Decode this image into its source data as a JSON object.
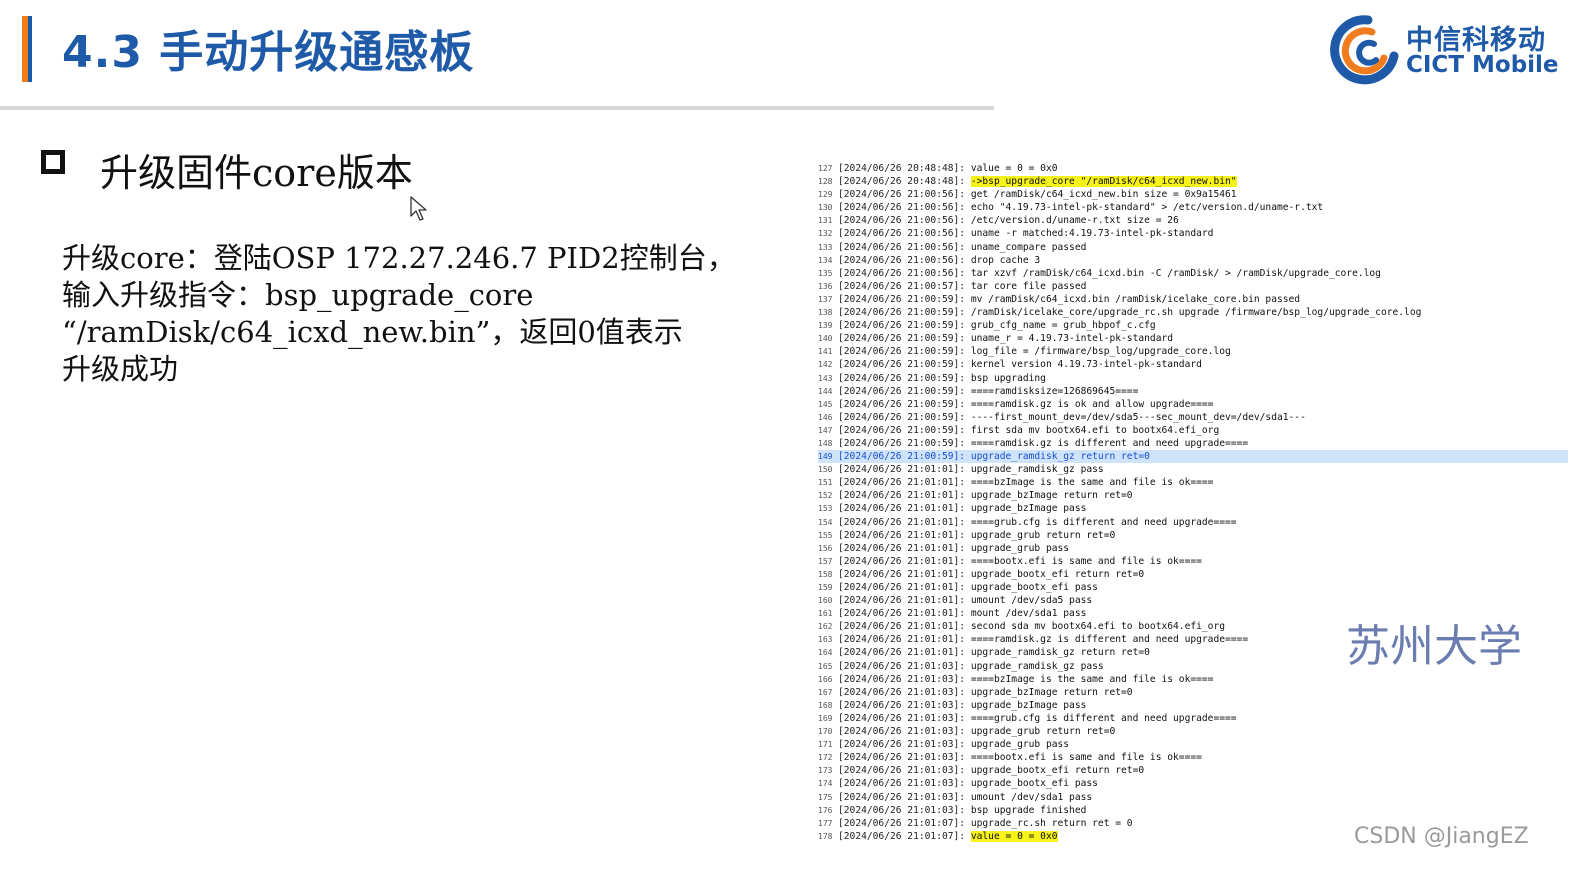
{
  "header": {
    "title": "4.3 手动升级通感板",
    "logo_cn": "中信科移动",
    "logo_en": "CICT Mobile",
    "accent_orange": "#f07c1e",
    "accent_blue": "#1e5aa8"
  },
  "section": {
    "heading": "升级固件core版本",
    "body_lines": [
      "升级core：登陆OSP 172.27.246.7  PID2控制台，",
      "输入升级指令：bsp_upgrade_core",
      "“/ramDisk/c64_icxd_new.bin”，返回0值表示",
      "升级成功"
    ]
  },
  "log": {
    "lines": [
      {
        "n": "127",
        "ts": "[2024/06/26 20:48:48]:",
        "msg": "value = 0 = 0x0",
        "hl": ""
      },
      {
        "n": "128",
        "ts": "[2024/06/26 20:48:48]:",
        "msg": "->bsp_upgrade_core \"/ramDisk/c64_icxd_new.bin\"",
        "hl": "yellow-msg"
      },
      {
        "n": "129",
        "ts": "[2024/06/26 21:00:56]:",
        "msg": "get /ramDisk/c64_icxd_new.bin size = 0x9a15461",
        "hl": ""
      },
      {
        "n": "130",
        "ts": "[2024/06/26 21:00:56]:",
        "msg": "echo \"4.19.73-intel-pk-standard\" > /etc/version.d/uname-r.txt",
        "hl": ""
      },
      {
        "n": "131",
        "ts": "[2024/06/26 21:00:56]:",
        "msg": "/etc/version.d/uname-r.txt size = 26",
        "hl": ""
      },
      {
        "n": "132",
        "ts": "[2024/06/26 21:00:56]:",
        "msg": "uname -r matched:4.19.73-intel-pk-standard",
        "hl": ""
      },
      {
        "n": "133",
        "ts": "[2024/06/26 21:00:56]:",
        "msg": "uname_compare passed",
        "hl": ""
      },
      {
        "n": "134",
        "ts": "[2024/06/26 21:00:56]:",
        "msg": "drop cache 3",
        "hl": ""
      },
      {
        "n": "135",
        "ts": "[2024/06/26 21:00:56]:",
        "msg": "tar xzvf /ramDisk/c64_icxd.bin -C /ramDisk/ > /ramDisk/upgrade_core.log",
        "hl": ""
      },
      {
        "n": "136",
        "ts": "[2024/06/26 21:00:57]:",
        "msg": "tar core file passed",
        "hl": ""
      },
      {
        "n": "137",
        "ts": "[2024/06/26 21:00:59]:",
        "msg": "mv /ramDisk/c64_icxd.bin /ramDisk/icelake_core.bin passed",
        "hl": ""
      },
      {
        "n": "138",
        "ts": "[2024/06/26 21:00:59]:",
        "msg": "/ramDisk/icelake_core/upgrade_rc.sh upgrade /firmware/bsp_log/upgrade_core.log",
        "hl": ""
      },
      {
        "n": "139",
        "ts": "[2024/06/26 21:00:59]:",
        "msg": "grub_cfg_name = grub_hbpof_c.cfg",
        "hl": ""
      },
      {
        "n": "140",
        "ts": "[2024/06/26 21:00:59]:",
        "msg": "uname_r = 4.19.73-intel-pk-standard",
        "hl": ""
      },
      {
        "n": "141",
        "ts": "[2024/06/26 21:00:59]:",
        "msg": "log_file = /firmware/bsp_log/upgrade_core.log",
        "hl": ""
      },
      {
        "n": "142",
        "ts": "[2024/06/26 21:00:59]:",
        "msg": "kernel version 4.19.73-intel-pk-standard",
        "hl": ""
      },
      {
        "n": "143",
        "ts": "[2024/06/26 21:00:59]:",
        "msg": "bsp upgrading",
        "hl": ""
      },
      {
        "n": "144",
        "ts": "[2024/06/26 21:00:59]:",
        "msg": "====ramdisksize=126869645====",
        "hl": ""
      },
      {
        "n": "145",
        "ts": "[2024/06/26 21:00:59]:",
        "msg": "====ramdisk.gz is ok and allow upgrade====",
        "hl": ""
      },
      {
        "n": "146",
        "ts": "[2024/06/26 21:00:59]:",
        "msg": "----first_mount_dev=/dev/sda5---sec_mount_dev=/dev/sda1---",
        "hl": ""
      },
      {
        "n": "147",
        "ts": "[2024/06/26 21:00:59]:",
        "msg": "first sda mv bootx64.efi to bootx64.efi_org",
        "hl": ""
      },
      {
        "n": "148",
        "ts": "[2024/06/26 21:00:59]:",
        "msg": "====ramdisk.gz is different and need upgrade====",
        "hl": ""
      },
      {
        "n": "149",
        "ts": "[2024/06/26 21:00:59]:",
        "msg": "upgrade_ramdisk_gz return ret=0",
        "hl": "blue"
      },
      {
        "n": "150",
        "ts": "[2024/06/26 21:01:01]:",
        "msg": "upgrade_ramdisk_gz pass",
        "hl": ""
      },
      {
        "n": "151",
        "ts": "[2024/06/26 21:01:01]:",
        "msg": "====bzImage is the same and file is ok====",
        "hl": ""
      },
      {
        "n": "152",
        "ts": "[2024/06/26 21:01:01]:",
        "msg": "upgrade_bzImage return ret=0",
        "hl": ""
      },
      {
        "n": "153",
        "ts": "[2024/06/26 21:01:01]:",
        "msg": "upgrade_bzImage pass",
        "hl": ""
      },
      {
        "n": "154",
        "ts": "[2024/06/26 21:01:01]:",
        "msg": "====grub.cfg is different and need upgrade====",
        "hl": ""
      },
      {
        "n": "155",
        "ts": "[2024/06/26 21:01:01]:",
        "msg": "upgrade_grub return ret=0",
        "hl": ""
      },
      {
        "n": "156",
        "ts": "[2024/06/26 21:01:01]:",
        "msg": "upgrade_grub pass",
        "hl": ""
      },
      {
        "n": "157",
        "ts": "[2024/06/26 21:01:01]:",
        "msg": "====bootx.efi is same and file is ok====",
        "hl": ""
      },
      {
        "n": "158",
        "ts": "[2024/06/26 21:01:01]:",
        "msg": "upgrade_bootx_efi return ret=0",
        "hl": ""
      },
      {
        "n": "159",
        "ts": "[2024/06/26 21:01:01]:",
        "msg": "upgrade_bootx_efi pass",
        "hl": ""
      },
      {
        "n": "160",
        "ts": "[2024/06/26 21:01:01]:",
        "msg": "umount /dev/sda5 pass",
        "hl": ""
      },
      {
        "n": "161",
        "ts": "[2024/06/26 21:01:01]:",
        "msg": "mount /dev/sda1 pass",
        "hl": ""
      },
      {
        "n": "162",
        "ts": "[2024/06/26 21:01:01]:",
        "msg": "second sda mv bootx64.efi to bootx64.efi_org",
        "hl": ""
      },
      {
        "n": "163",
        "ts": "[2024/06/26 21:01:01]:",
        "msg": "====ramdisk.gz is different and need upgrade====",
        "hl": ""
      },
      {
        "n": "164",
        "ts": "[2024/06/26 21:01:01]:",
        "msg": "upgrade_ramdisk_gz return ret=0",
        "hl": ""
      },
      {
        "n": "165",
        "ts": "[2024/06/26 21:01:03]:",
        "msg": "upgrade_ramdisk_gz pass",
        "hl": ""
      },
      {
        "n": "166",
        "ts": "[2024/06/26 21:01:03]:",
        "msg": "====bzImage is the same and file is ok====",
        "hl": ""
      },
      {
        "n": "167",
        "ts": "[2024/06/26 21:01:03]:",
        "msg": "upgrade_bzImage return ret=0",
        "hl": ""
      },
      {
        "n": "168",
        "ts": "[2024/06/26 21:01:03]:",
        "msg": "upgrade_bzImage pass",
        "hl": ""
      },
      {
        "n": "169",
        "ts": "[2024/06/26 21:01:03]:",
        "msg": "====grub.cfg is different and need upgrade====",
        "hl": ""
      },
      {
        "n": "170",
        "ts": "[2024/06/26 21:01:03]:",
        "msg": "upgrade_grub return ret=0",
        "hl": ""
      },
      {
        "n": "171",
        "ts": "[2024/06/26 21:01:03]:",
        "msg": "upgrade_grub pass",
        "hl": ""
      },
      {
        "n": "172",
        "ts": "[2024/06/26 21:01:03]:",
        "msg": "====bootx.efi is same and file is ok====",
        "hl": ""
      },
      {
        "n": "173",
        "ts": "[2024/06/26 21:01:03]:",
        "msg": "upgrade_bootx_efi return ret=0",
        "hl": ""
      },
      {
        "n": "174",
        "ts": "[2024/06/26 21:01:03]:",
        "msg": "upgrade_bootx_efi pass",
        "hl": ""
      },
      {
        "n": "175",
        "ts": "[2024/06/26 21:01:03]:",
        "msg": "umount /dev/sda1 pass",
        "hl": ""
      },
      {
        "n": "176",
        "ts": "[2024/06/26 21:01:03]:",
        "msg": "bsp upgrade finished",
        "hl": ""
      },
      {
        "n": "177",
        "ts": "[2024/06/26 21:01:07]:",
        "msg": "upgrade_rc.sh return ret = 0",
        "hl": ""
      },
      {
        "n": "178",
        "ts": "[2024/06/26 21:01:07]:",
        "msg": "value = 0 = 0x0",
        "hl": "yellow-msg"
      }
    ]
  },
  "watermarks": {
    "school": "苏州大学",
    "csdn": "CSDN @JiangEZ"
  }
}
